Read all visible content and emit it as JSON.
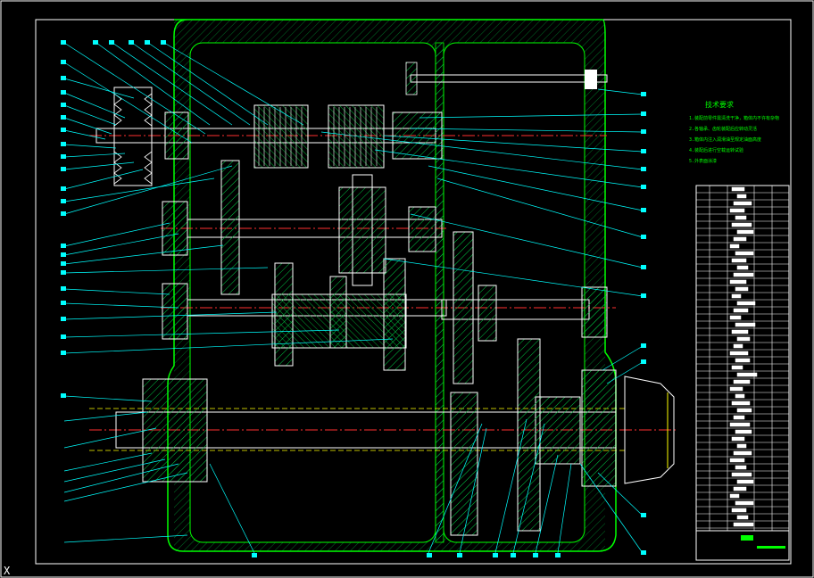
{
  "drawing": {
    "title": "技术要求",
    "notes": [
      "1.装配前零件需清洗干净，箱体内不许有杂物",
      "2.各轴承、齿轮装配后应转动灵活",
      "3.箱体内注入润滑油至规定油面高度",
      "4.装配后进行空载运转试验",
      "5.外表面涂漆"
    ],
    "colors": {
      "background": "#000000",
      "outline": "#ffffff",
      "body": "#00ff00",
      "leader": "#00ffff",
      "center": "#ff3030",
      "hidden": "#ffff00",
      "hatch": "#00cc44"
    }
  }
}
